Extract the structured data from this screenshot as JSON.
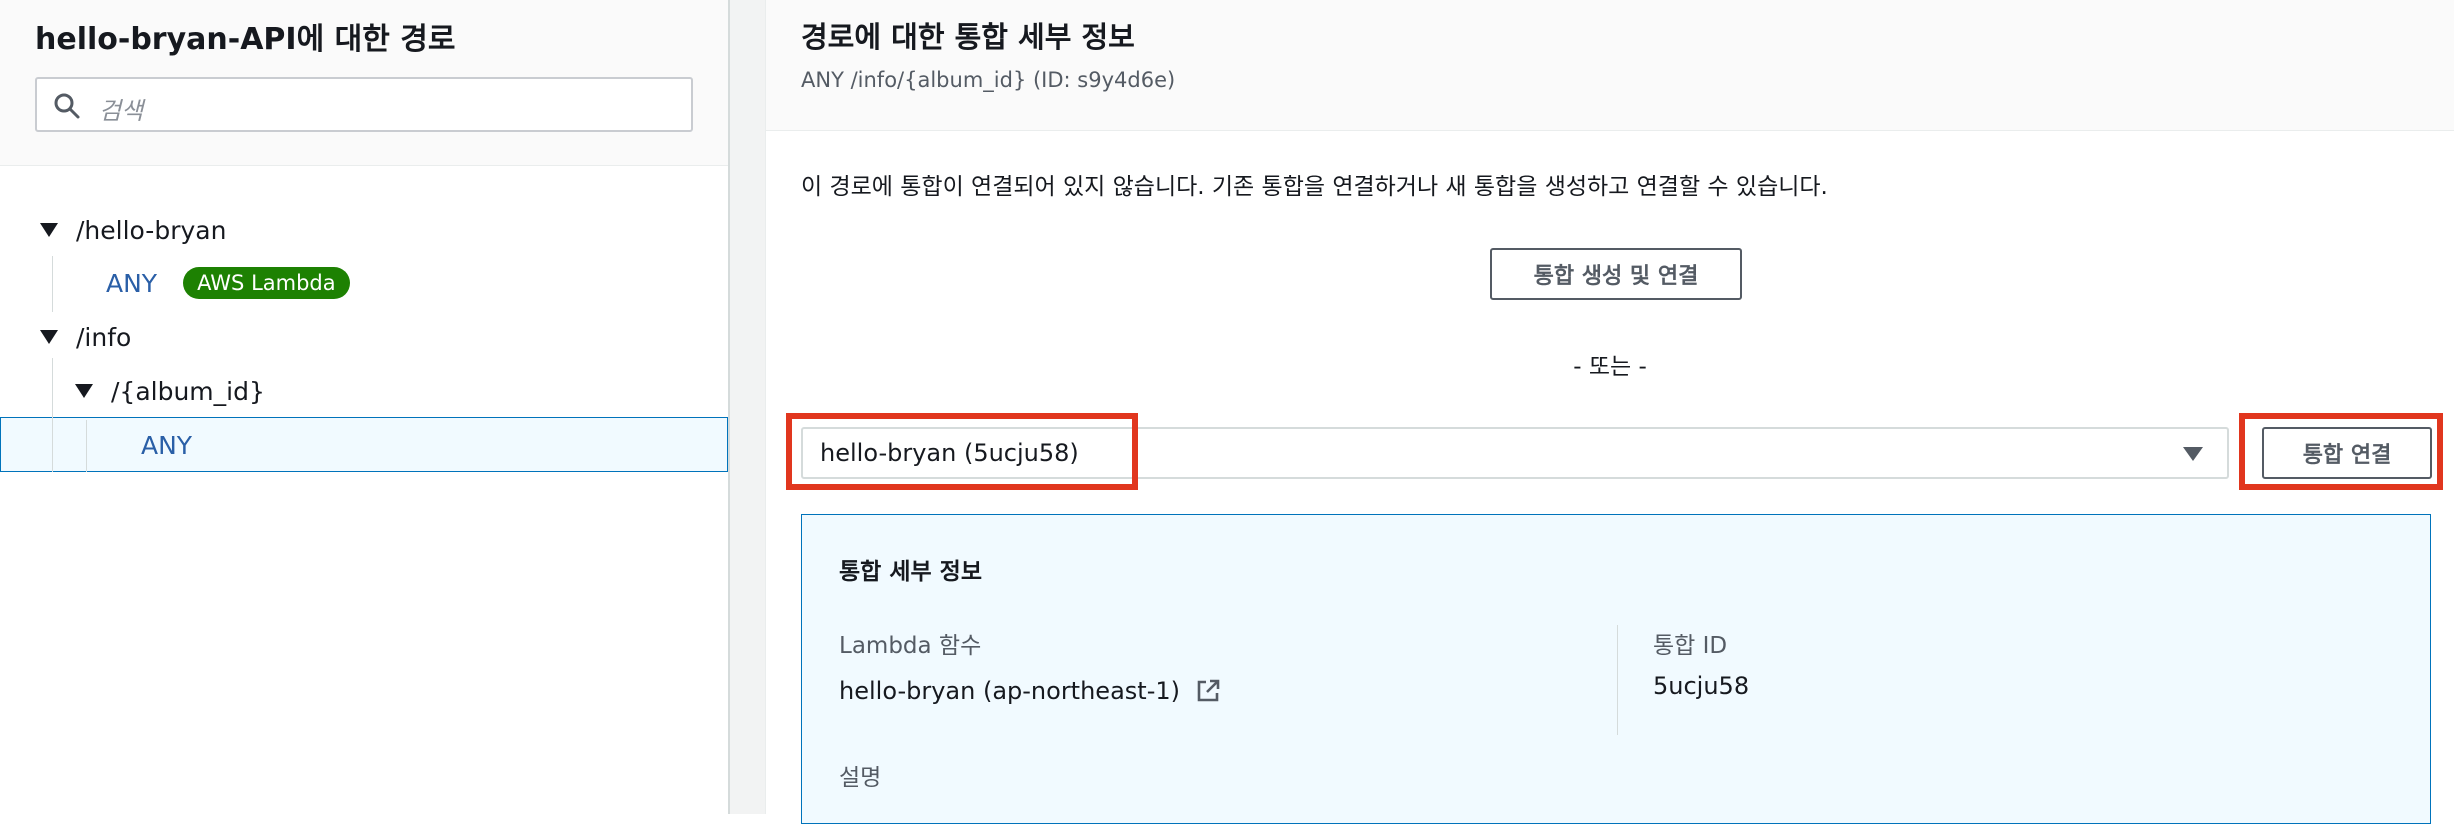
{
  "left": {
    "title": "hello-bryan-API에 대한 경로",
    "search_placeholder": "검색",
    "tree": [
      {
        "label": "/hello-bryan"
      },
      {
        "method": "ANY",
        "badge": "AWS Lambda"
      },
      {
        "label": "/info"
      },
      {
        "label": "/{album_id}"
      },
      {
        "method": "ANY"
      }
    ]
  },
  "right": {
    "title": "경로에 대한 통합 세부 정보",
    "subtitle": "ANY /info/{album_id} (ID: s9y4d6e)",
    "info_text": "이 경로에 통합이 연결되어 있지 않습니다. 기존 통합을 연결하거나 새 통합을 생성하고 연결할 수 있습니다.",
    "create_button": "통합 생성 및 연결",
    "or_text": "- 또는 -",
    "select_value": "hello-bryan (5ucju58)",
    "attach_button": "통합 연결",
    "details": {
      "title": "통합 세부 정보",
      "lambda_label": "Lambda 함수",
      "lambda_value": "hello-bryan (ap-northeast-1)",
      "id_label": "통합 ID",
      "id_value": "5ucju58",
      "desc_label": "설명"
    }
  },
  "colors": {
    "highlight": "#e1361e",
    "badge": "#1d8102",
    "link": "#2a5fa7"
  }
}
